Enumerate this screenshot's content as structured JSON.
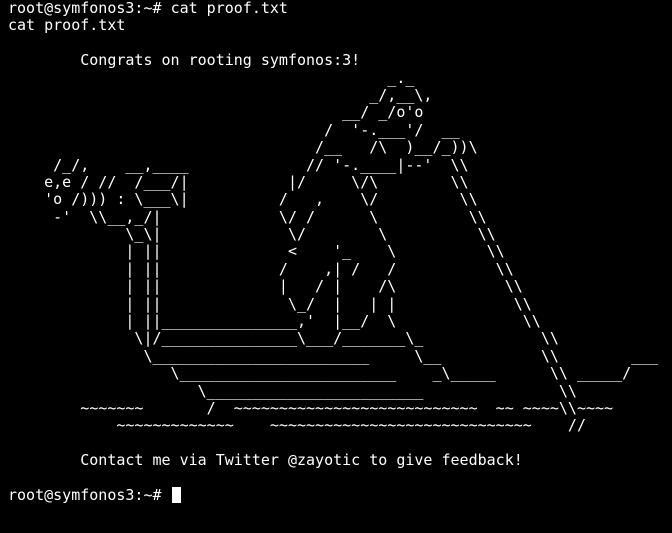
{
  "terminal": {
    "prompt": "root@symfonos3:~# ",
    "command": "cat proof.txt",
    "echo": "cat proof.txt",
    "output": [
      "",
      "        Congrats on rooting symfonos:3!",
      "                                          _._",
      "                                        _/,__\\,",
      "                                     __/ _/o'o",
      "                                   /  '-.___'/  __",
      "                                  /__   /\\  )__/_))\\",
      "     /_/,    __,____             // '-.____|--'  \\\\",
      "    e,e / //  /___/|           |/     \\/\\        \\\\",
      "    'o /))) : \\___\\|          /   ,    \\/         \\\\",
      "     -'  \\\\__,_/|             \\/ /      \\          \\\\",
      "             \\_\\|              \\/        \\          \\\\",
      "             | ||              <    '_    \\          \\\\",
      "             | ||             /    ,| /   /           \\\\",
      "             | ||             |   / |    /\\            \\\\",
      "             | ||              \\_/  |   | |             \\\\",
      "             | ||_______________,'  |__/  \\              \\\\",
      "              \\|/_______________\\___/_______\\_             \\\\",
      "               \\________________________     \\__           \\\\        ___",
      "                  \\________________________    _\\_____      \\\\ _____/",
      "                     \\________________________               \\\\",
      "        ~~~~~~~       /  ~~~~~~~~~~~~~~~~~~~~~~~~~~~  ~~ ~~~~\\\\~~~~",
      "            ~~~~~~~~~~~~~    ~~~~~~~~~~~~~~~~~~~~~~~~~~~~~    //",
      "",
      "        Contact me via Twitter @zayotic to give feedback!",
      ""
    ],
    "final_prompt": "root@symfonos3:~# "
  }
}
